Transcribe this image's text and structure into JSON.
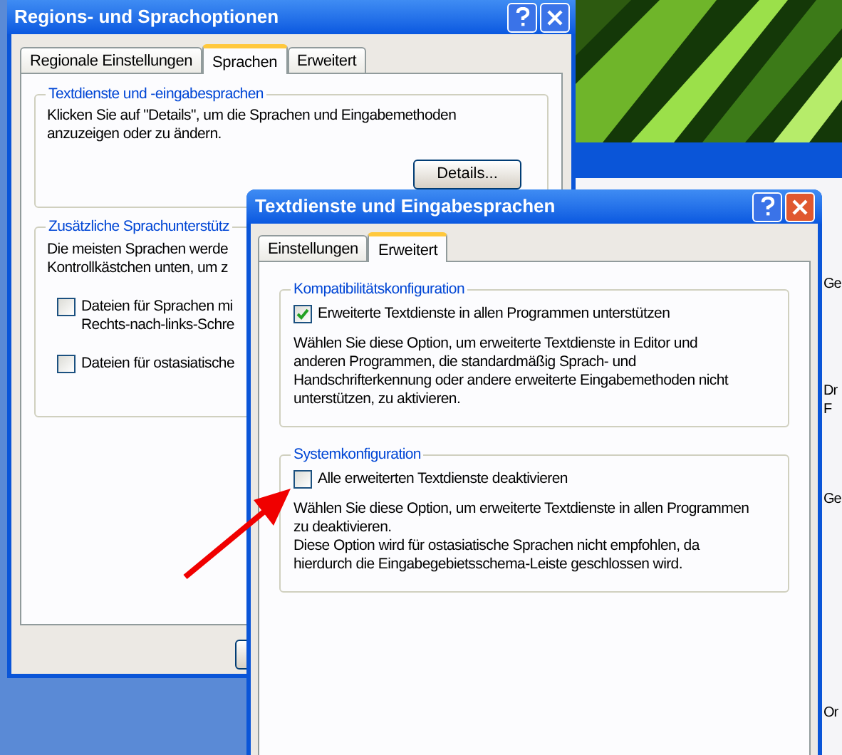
{
  "back_window": {
    "title": "Regions- und Sprachoptionen",
    "tabs": [
      {
        "label": "Regionale Einstellungen",
        "selected": false
      },
      {
        "label": "Sprachen",
        "selected": true
      },
      {
        "label": "Erweitert",
        "selected": false
      }
    ],
    "group_1": {
      "title": "Textdienste und -eingabesprachen",
      "lines": [
        "Klicken Sie auf \"Details\", um die Sprachen und Eingabemethoden",
        "anzuzeigen oder zu ändern."
      ],
      "button": "Details..."
    },
    "group_2": {
      "title": "Zusätzliche Sprachunterstütz",
      "lines": [
        "Die meisten Sprachen werde",
        "Kontrollkästchen unten, um z"
      ],
      "checkboxes": [
        {
          "lines": [
            "Dateien für Sprachen mi",
            "Rechts-nach-links-Schre"
          ],
          "checked": false
        },
        {
          "lines": [
            "Dateien für ostasiatische"
          ],
          "checked": false
        }
      ]
    }
  },
  "side_window": {
    "fragments": [
      "Ge",
      "Dr",
      "F",
      "Ge",
      "Or"
    ]
  },
  "dialog": {
    "title": "Textdienste und Eingabesprachen",
    "tabs": [
      {
        "label": "Einstellungen",
        "selected": false
      },
      {
        "label": "Erweitert",
        "selected": true
      }
    ],
    "groups": [
      {
        "title": "Kompatibilitätskonfiguration",
        "checkbox": {
          "label": "Erweiterte Textdienste in allen Programmen unterstützen",
          "checked": true
        },
        "lines": [
          "Wählen Sie diese Option, um erweiterte Textdienste in Editor und",
          "anderen Programmen, die standardmäßig Sprach- und",
          "Handschrifterkennung oder andere erweiterte Eingabemethoden nicht",
          "unterstützen, zu aktivieren."
        ]
      },
      {
        "title": "Systemkonfiguration",
        "checkbox": {
          "label": "Alle erweiterten Textdienste deaktivieren",
          "checked": false
        },
        "lines": [
          "Wählen Sie diese Option, um erweiterte Textdienste in allen Programmen",
          "zu deaktivieren.",
          "Diese Option wird für ostasiatische Sprachen nicht empfohlen, da",
          "hierdurch die Eingabegebietsschema-Leiste geschlossen wird."
        ]
      }
    ]
  }
}
